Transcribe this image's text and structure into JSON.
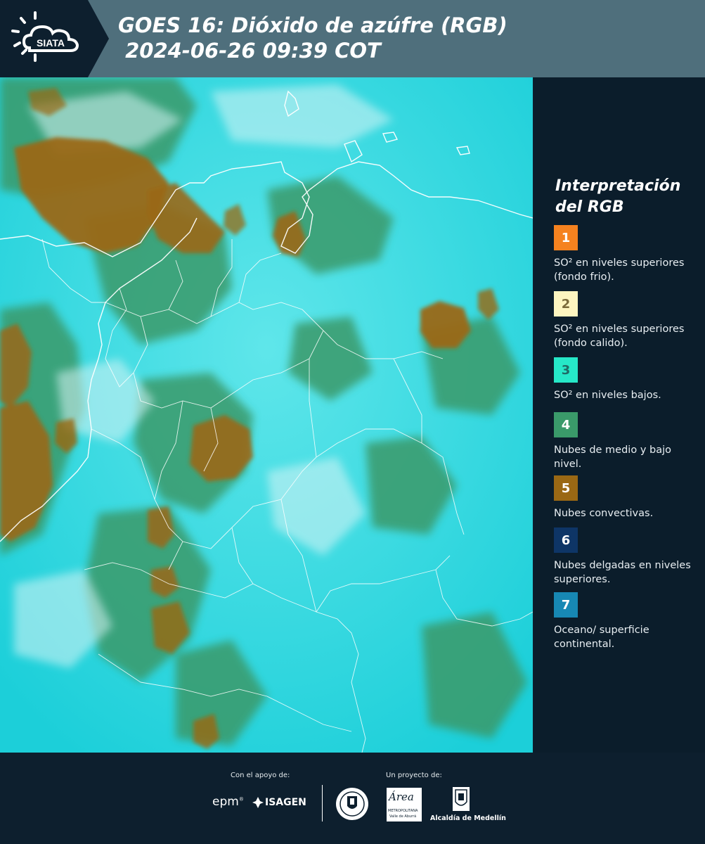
{
  "header": {
    "logo_text": "SIATA",
    "title_line1": "GOES 16: Dióxido de azúfre (RGB)",
    "title_line2": " 2024-06-26 09:39 COT"
  },
  "legend": {
    "title": "Interpretación del RGB",
    "items": [
      {
        "number": "1",
        "color": "#f5821f",
        "number_color": "#ffffff",
        "text": "SO² en niveles superiores (fondo frio)."
      },
      {
        "number": "2",
        "color": "#fdf5c0",
        "number_color": "#7a6a3a",
        "text": "SO² en niveles superiores (fondo calido)."
      },
      {
        "number": "3",
        "color": "#26e8c8",
        "number_color": "#1f6b66",
        "text": "SO² en niveles bajos."
      },
      {
        "number": "4",
        "color": "#3a9a6a",
        "number_color": "#ffffff",
        "text": "Nubes de medio y bajo nivel."
      },
      {
        "number": "5",
        "color": "#9a6814",
        "number_color": "#ffffff",
        "text": "Nubes convectivas."
      },
      {
        "number": "6",
        "color": "#0e3566",
        "number_color": "#ffffff",
        "text": "Nubes delgadas en niveles superiores."
      },
      {
        "number": "7",
        "color": "#1788b4",
        "number_color": "#ffffff",
        "text": "Oceano/ superficie continental."
      }
    ]
  },
  "footer": {
    "support_label": "Con el apoyo de:",
    "project_label": "Un proyecto de:",
    "epm": "epm",
    "isagen": "ISAGEN",
    "area_top": "Área",
    "area_sub": "METROPOLITANA",
    "area_sub2": "Valle de Aburrá",
    "alcaldia": "Alcaldía de Medellín"
  },
  "colors": {
    "map_background": "#1fd3dd",
    "cloud_brown": "#9a6814",
    "cloud_green": "#3a9a6a",
    "header_bar": "#4f6f7c",
    "dark_panel": "#0d1f2e"
  }
}
